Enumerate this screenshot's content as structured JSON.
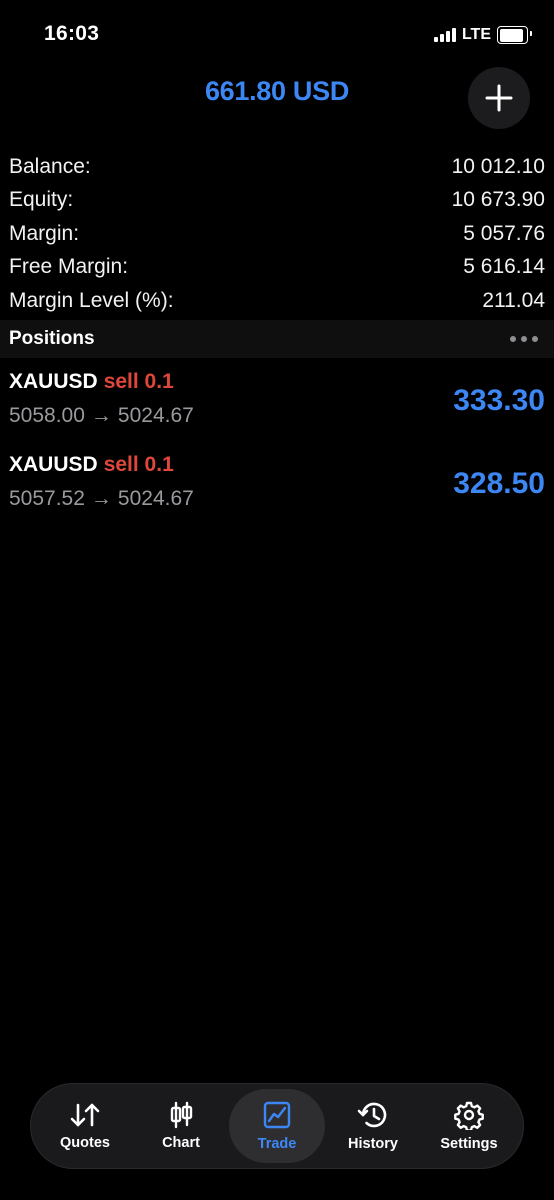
{
  "status_bar": {
    "time": "16:03",
    "network": "LTE",
    "battery_fraction": 0.9
  },
  "header": {
    "title": "661.80 USD",
    "add_icon": "plus-icon"
  },
  "summary": [
    {
      "label": "Balance:",
      "value": "10 012.10"
    },
    {
      "label": "Equity:",
      "value": "10 673.90"
    },
    {
      "label": "Margin:",
      "value": "5 057.76"
    },
    {
      "label": "Free Margin:",
      "value": "5 616.14"
    },
    {
      "label": "Margin Level (%):",
      "value": "211.04"
    }
  ],
  "positions": {
    "title": "Positions",
    "items": [
      {
        "symbol": "XAUUSD",
        "type": "sell 0.1",
        "open_price": "5058.00",
        "arrow": "→",
        "current_price": "5024.67",
        "profit": "333.30"
      },
      {
        "symbol": "XAUUSD",
        "type": "sell 0.1",
        "open_price": "5057.52",
        "arrow": "→",
        "current_price": "5024.67",
        "profit": "328.50"
      }
    ]
  },
  "tabs": [
    {
      "label": "Quotes",
      "icon": "quotes-arrows-icon",
      "active": false
    },
    {
      "label": "Chart",
      "icon": "candlestick-icon",
      "active": false
    },
    {
      "label": "Trade",
      "icon": "trade-chart-icon",
      "active": true
    },
    {
      "label": "History",
      "icon": "history-clock-icon",
      "active": false
    },
    {
      "label": "Settings",
      "icon": "gear-icon",
      "active": false
    }
  ],
  "colors": {
    "accent": "#3d87f5",
    "sell": "#e0473c",
    "background": "#000000"
  }
}
